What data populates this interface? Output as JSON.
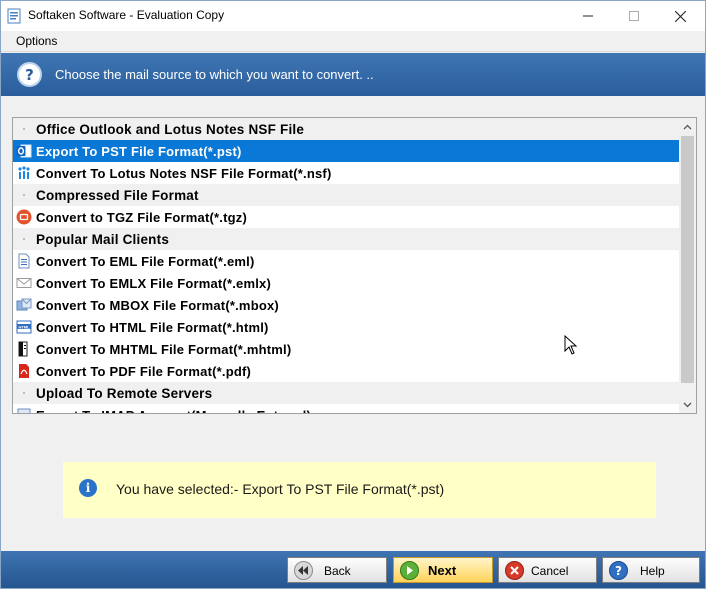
{
  "window": {
    "title": "Softaken Software - Evaluation Copy"
  },
  "menu": {
    "options_label": "Options"
  },
  "banner": {
    "text": "Choose the mail source to which you want to convert. ..",
    "icon": "question-icon"
  },
  "list": {
    "rows": [
      {
        "label": "Office Outlook and Lotus Notes NSF File",
        "type": "group",
        "icon": "none"
      },
      {
        "label": "Export To PST File Format(*.pst)",
        "type": "item",
        "icon": "outlook-icon",
        "selected": true
      },
      {
        "label": "Convert To Lotus Notes NSF File Format(*.nsf)",
        "type": "item",
        "icon": "lotus-notes-icon"
      },
      {
        "label": "Compressed File Format",
        "type": "group",
        "icon": "none"
      },
      {
        "label": "Convert to TGZ File Format(*.tgz)",
        "type": "item",
        "icon": "tgz-icon"
      },
      {
        "label": "Popular Mail Clients",
        "type": "group",
        "icon": "none"
      },
      {
        "label": "Convert To EML File Format(*.eml)",
        "type": "item",
        "icon": "eml-file-icon"
      },
      {
        "label": "Convert To EMLX File Format(*.emlx)",
        "type": "item",
        "icon": "envelope-icon"
      },
      {
        "label": "Convert To MBOX File Format(*.mbox)",
        "type": "item",
        "icon": "mbox-icon"
      },
      {
        "label": "Convert To HTML File Format(*.html)",
        "type": "item",
        "icon": "html-icon"
      },
      {
        "label": "Convert To MHTML File Format(*.mhtml)",
        "type": "item",
        "icon": "mhtml-icon"
      },
      {
        "label": "Convert To PDF File Format(*.pdf)",
        "type": "item",
        "icon": "pdf-icon"
      },
      {
        "label": "Upload To Remote Servers",
        "type": "group",
        "icon": "none"
      },
      {
        "label": "Export To IMAP Account(Manually Entered)",
        "type": "item",
        "icon": "server-icon"
      }
    ]
  },
  "info": {
    "text": "You have selected:- Export To PST File Format(*.pst)",
    "icon": "info-icon"
  },
  "buttons": {
    "back": "Back",
    "next": "Next",
    "cancel": "Cancel",
    "help": "Help"
  },
  "colors": {
    "banner": "#2a5d9c",
    "selection": "#0a78d7",
    "info_bg": "#ffffc6"
  }
}
